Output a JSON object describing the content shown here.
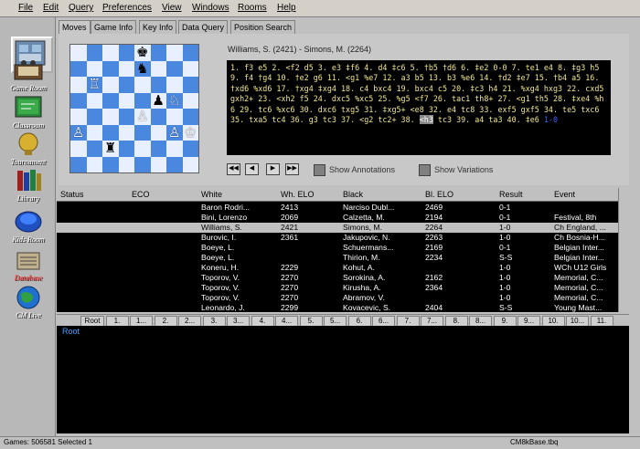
{
  "menu": [
    "File",
    "Edit",
    "Query",
    "Preferences",
    "View",
    "Windows",
    "Rooms",
    "Help"
  ],
  "sidebar": [
    {
      "label": "Game Room",
      "icon": "game-room-icon"
    },
    {
      "label": "Classroom",
      "icon": "classroom-icon"
    },
    {
      "label": "Tournament",
      "icon": "tournament-icon"
    },
    {
      "label": "Library",
      "icon": "library-icon"
    },
    {
      "label": "Kids Room",
      "icon": "kids-room-icon"
    },
    {
      "label": "Database",
      "icon": "database-icon",
      "accent": "red"
    },
    {
      "label": "CM Live",
      "icon": "cm-live-icon"
    }
  ],
  "tabs": [
    "Moves",
    "Game Info",
    "Key Info",
    "Data Query",
    "Position Search"
  ],
  "game_header": "Williams, S. (2421) - Simons, M. (2264)",
  "notation": {
    "main": "1. f3 e5 2. <f2 d5 3. e3 ‡f6 4. d4 ‡c6 5. †b5 †d6 6. ‡e2 0-0 7. te1 e4 8. ‡g3 h5 9. f4 †g4 10. †e2 g6 11. <g1 %e7 12. a3 b5 13. b3 %e6 14. †d2 ‡e7 15. †b4 a5 16. †xd6 %xd6 17. †xg4 ‡xg4 18. c4 bxc4 19. bxc4 c5 20. ‡c3 h4 21. %xg4 hxg3 22. cxd5 gxh2+ 23. <xh2 f5 24. dxc5 %xc5 25. %g5 <f7 26. tac1 th8+ 27. <g1 th5 28. ‡xe4 %h6 29. tc6 %xc6 30. dxc6 txg5 31. ‡xg5+ <e8 32. e4 tc8 33. exf5 gxf5 34. te5 txc6 35. txa5 tc4 36. g3 tc3 37. <g2 tc2+ 38. ",
    "current": "<h3",
    "tail": " tc3 39. a4 ta3 40. ‡e6 ",
    "result": "1-0"
  },
  "controls": {
    "show_annotations": "Show Annotations",
    "show_variations": "Show Variations"
  },
  "table": {
    "columns": [
      "Status",
      "ECO",
      "White",
      "Wh. ELO",
      "Black",
      "Bl. ELO",
      "Result",
      "Event"
    ],
    "rows": [
      [
        "",
        "",
        "Baron Rodri...",
        "2413",
        "Narciso Dubl...",
        "2469",
        "0-1",
        ""
      ],
      [
        "",
        "",
        "Bini, Lorenzo",
        "2069",
        "Calzetta, M.",
        "2194",
        "0-1",
        "Festival, 8th"
      ],
      [
        "",
        "",
        "Williams, S.",
        "2421",
        "Simons, M.",
        "2264",
        "1-0",
        "Ch England, ..."
      ],
      [
        "",
        "",
        "Burovic, I.",
        "2361",
        "Jakupovic, N.",
        "2263",
        "1-0",
        "Ch Bosnia-H..."
      ],
      [
        "",
        "",
        "Boeye, L.",
        "",
        "Schuermans...",
        "2169",
        "0-1",
        "Belgian Inter..."
      ],
      [
        "",
        "",
        "Boeye, L.",
        "",
        "Thirion, M.",
        "2234",
        "S-S",
        "Belgian Inter..."
      ],
      [
        "",
        "",
        "Koneru, H.",
        "2229",
        "Kohut, A.",
        "",
        "1-0",
        "WCh U12 Girls"
      ],
      [
        "",
        "",
        "Toporov, V.",
        "2270",
        "Sorokina, A.",
        "2162",
        "1-0",
        "Memorial, C..."
      ],
      [
        "",
        "",
        "Toporov, V.",
        "2270",
        "Kirusha, A.",
        "2364",
        "1-0",
        "Memorial, C..."
      ],
      [
        "",
        "",
        "Toporov, V.",
        "2270",
        "Abramov, V.",
        "",
        "1-0",
        "Memorial, C..."
      ],
      [
        "",
        "",
        "Leonardo, J.",
        "2299",
        "Kovacevic, S.",
        "2404",
        "S-S",
        "Young Mast..."
      ]
    ],
    "selected_row": 2
  },
  "tree_nodes": [
    "Root",
    "1.",
    "1...",
    "2.",
    "2...",
    "3.",
    "3...",
    "4.",
    "4...",
    "5.",
    "5...",
    "6.",
    "6...",
    "7.",
    "7...",
    "8.",
    "8...",
    "9.",
    "9...",
    "10.",
    "10...",
    "11."
  ],
  "tree_root_label": "Root",
  "status": {
    "left": "Games: 506581  Selected 1",
    "right": "CM8kBase.tbq"
  },
  "colors": {
    "board_light": "#e8f0ff",
    "board_dark": "#4a88e0",
    "notation_text": "#f0e68c"
  }
}
